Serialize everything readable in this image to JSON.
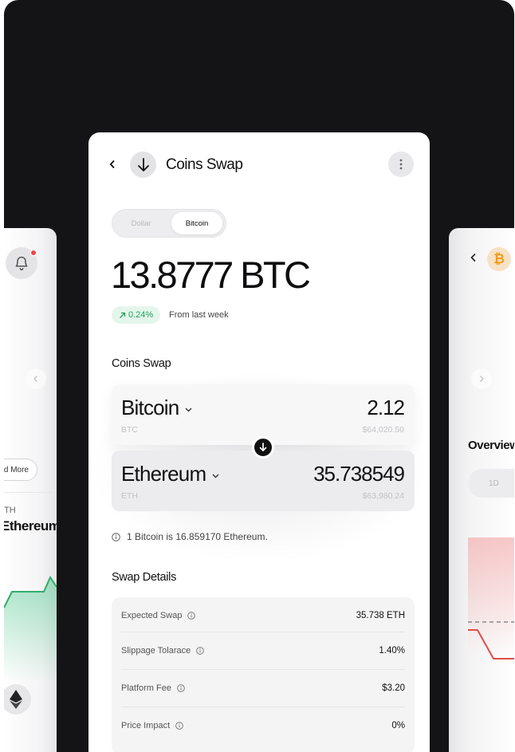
{
  "left_card": {
    "read_more_label": "d More",
    "coin_symbol": "TH",
    "coin_name": "Ethereum"
  },
  "right_card": {
    "section_title": "Overview",
    "period_label": "1D"
  },
  "header": {
    "title": "Coins Swap"
  },
  "currency_toggle": {
    "options": [
      "Dollar",
      "Bitcoin"
    ],
    "selected": "Bitcoin"
  },
  "balance": {
    "amount": "13.8777 BTC",
    "change": "0.24%",
    "change_label": "From last week"
  },
  "swap": {
    "section_title": "Coins Swap",
    "from": {
      "name": "Bitcoin",
      "symbol": "BTC",
      "amount": "2.12",
      "fiat": "$64,020.50"
    },
    "to": {
      "name": "Ethereum",
      "symbol": "ETH",
      "amount": "35.738549",
      "fiat": "$63,980.24"
    },
    "rate_info": "1 Bitcoin is 16.859170 Ethereum."
  },
  "swap_details": {
    "title": "Swap Details",
    "rows": [
      {
        "label": "Expected Swap",
        "value": "35.738 ETH"
      },
      {
        "label": "Slippage Tolarace",
        "value": "1.40%"
      },
      {
        "label": "Platform Fee",
        "value": "$3.20"
      },
      {
        "label": "Price Impact",
        "value": "0%"
      }
    ]
  },
  "colors": {
    "background": "#141416",
    "accent_green": "#22a062",
    "bitcoin_orange": "#f39b1a",
    "alert_red": "#ef4444"
  },
  "icons": {
    "back": "chevron-left-icon",
    "swap": "arrow-down-icon",
    "more": "more-vertical-icon",
    "bell": "bell-icon",
    "trend": "arrow-up-right-icon",
    "info": "info-icon",
    "ethereum": "ethereum-icon",
    "bitcoin": "bitcoin-icon"
  }
}
